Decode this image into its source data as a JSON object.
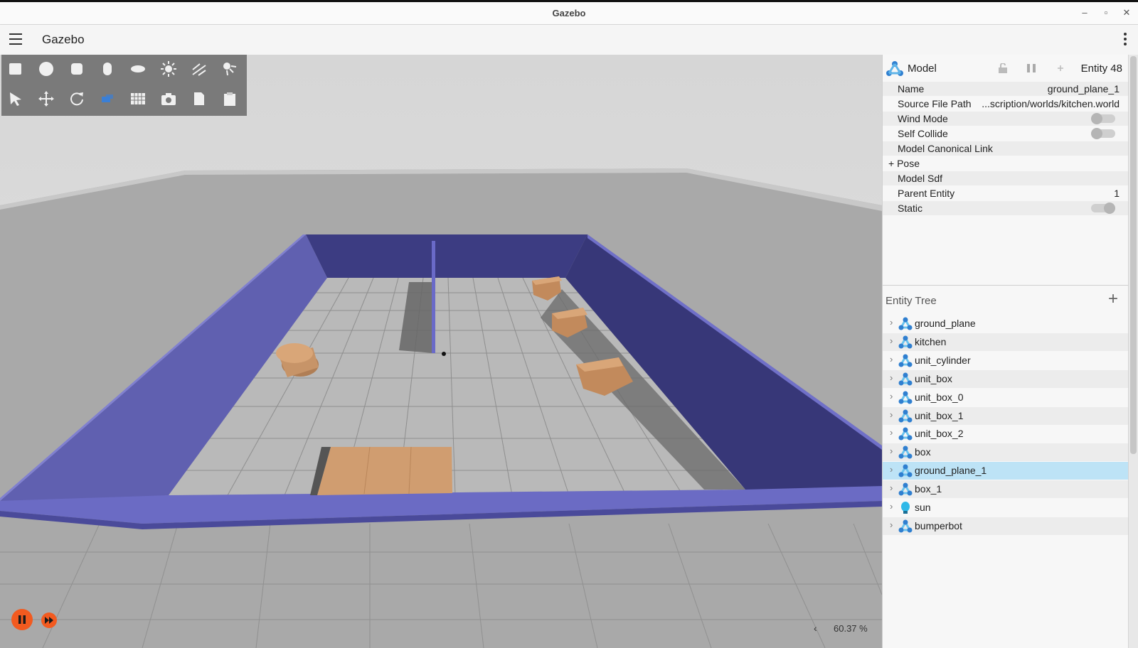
{
  "window": {
    "title": "Gazebo",
    "controls": [
      "–",
      "▫",
      "✕"
    ]
  },
  "appbar": {
    "title": "Gazebo"
  },
  "toolbar": {
    "shapes": [
      "box-icon",
      "sphere-icon",
      "cylinder-icon",
      "capsule-icon",
      "ellipsoid-icon",
      "sun-icon",
      "directional-light-icon",
      "spot-light-icon"
    ],
    "tools": [
      "select-icon",
      "translate-icon",
      "rotate-icon",
      "transform-control-icon",
      "grid-snap-icon",
      "camera-icon",
      "copy-icon",
      "paste-icon"
    ]
  },
  "viewport": {
    "zoom": "60.37 %",
    "zoom_arrow": "‹"
  },
  "component_inspector": {
    "header_label": "Model",
    "entity_label": "Entity 48",
    "properties": [
      {
        "key": "Name",
        "value": "ground_plane_1"
      },
      {
        "key": "Source File Path",
        "value": "...scription/worlds/kitchen.world"
      },
      {
        "key": "Wind Mode",
        "value": "",
        "toggle": "off"
      },
      {
        "key": "Self Collide",
        "value": "",
        "toggle": "off"
      },
      {
        "key": "Model Canonical Link",
        "value": ""
      },
      {
        "key": "+ Pose",
        "value": ""
      },
      {
        "key": "Model Sdf",
        "value": ""
      },
      {
        "key": "Parent Entity",
        "value": "1"
      },
      {
        "key": "Static",
        "value": "",
        "toggle": "on"
      }
    ]
  },
  "entity_tree": {
    "title": "Entity Tree",
    "add": "+",
    "items": [
      {
        "label": "ground_plane",
        "icon": "model-icon"
      },
      {
        "label": "kitchen",
        "icon": "model-icon"
      },
      {
        "label": "unit_cylinder",
        "icon": "model-icon"
      },
      {
        "label": "unit_box",
        "icon": "model-icon"
      },
      {
        "label": "unit_box_0",
        "icon": "model-icon"
      },
      {
        "label": "unit_box_1",
        "icon": "model-icon"
      },
      {
        "label": "unit_box_2",
        "icon": "model-icon"
      },
      {
        "label": "box",
        "icon": "model-icon"
      },
      {
        "label": "ground_plane_1",
        "icon": "model-icon",
        "selected": true
      },
      {
        "label": "box_1",
        "icon": "model-icon"
      },
      {
        "label": "sun",
        "icon": "light-bulb-icon"
      },
      {
        "label": "bumperbot",
        "icon": "model-icon"
      }
    ]
  },
  "colors": {
    "wall": "#5f5fb0",
    "wall_dark": "#3f3f8a",
    "box": "#cf9a6b",
    "play": "#f25a1f",
    "selection": "#bde3f6"
  }
}
